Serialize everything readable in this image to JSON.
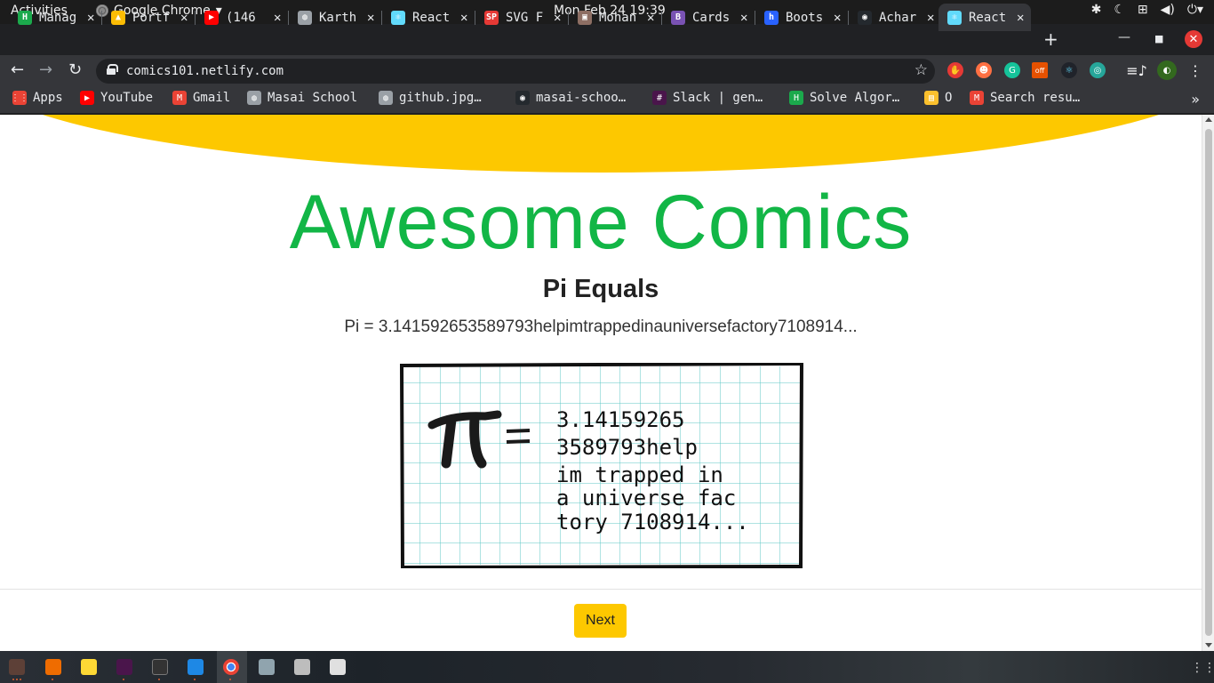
{
  "system": {
    "activities": "Activities",
    "app_name": "Google Chrome",
    "clock": "Mon Feb 24  19:39"
  },
  "tabs": [
    {
      "title": "Manag",
      "icon": "hackerrank-icon",
      "color": "#1ba94c",
      "glyph": "H"
    },
    {
      "title": "Portf",
      "icon": "google-drive-icon",
      "color": "#fbbc04",
      "glyph": "▲"
    },
    {
      "title": "(146",
      "icon": "youtube-icon",
      "color": "#ff0000",
      "glyph": "▶"
    },
    {
      "title": "Karth",
      "icon": "globe-icon",
      "color": "#9aa0a6",
      "glyph": "◍"
    },
    {
      "title": "React",
      "icon": "react-icon",
      "color": "#61dafb",
      "glyph": "⚛"
    },
    {
      "title": "SVG F",
      "icon": "svg-icon",
      "color": "#e53935",
      "glyph": "SP"
    },
    {
      "title": "Mohan",
      "icon": "photo-icon",
      "color": "#8d6e63",
      "glyph": "▣"
    },
    {
      "title": "Cards",
      "icon": "bootstrap-icon",
      "color": "#7952b3",
      "glyph": "B"
    },
    {
      "title": "Boots",
      "icon": "hashnode-icon",
      "color": "#2962ff",
      "glyph": "h"
    },
    {
      "title": "Achar",
      "icon": "github-icon",
      "color": "#24292e",
      "glyph": "◉"
    },
    {
      "title": "React",
      "icon": "react-icon",
      "color": "#61dafb",
      "glyph": "⚛",
      "active": true
    }
  ],
  "address": {
    "url": "comics101.netlify.com"
  },
  "bookmarks": [
    {
      "label": "Apps",
      "icon": "apps-grid-icon",
      "color": "#ea4335",
      "glyph": "⋮⋮"
    },
    {
      "label": "YouTube",
      "icon": "youtube-icon",
      "color": "#ff0000",
      "glyph": "▶"
    },
    {
      "label": "Gmail",
      "icon": "gmail-icon",
      "color": "#ea4335",
      "glyph": "M"
    },
    {
      "label": "Masai School",
      "icon": "globe-icon",
      "color": "#9aa0a6",
      "glyph": "◍"
    },
    {
      "label": "github.jpg…",
      "icon": "globe-icon",
      "color": "#9aa0a6",
      "glyph": "◍"
    },
    {
      "label": "masai-schoo…",
      "icon": "github-icon",
      "color": "#24292e",
      "glyph": "◉"
    },
    {
      "label": "Slack | gen…",
      "icon": "slack-icon",
      "color": "#4a154b",
      "glyph": "#"
    },
    {
      "label": "Solve Algor…",
      "icon": "hackerrank-icon",
      "color": "#1ba94c",
      "glyph": "H"
    },
    {
      "label": "O",
      "icon": "bookmark-folder-icon",
      "color": "#fbc02d",
      "glyph": "▤"
    },
    {
      "label": "Search resu…",
      "icon": "gmail-icon",
      "color": "#ea4335",
      "glyph": "M"
    }
  ],
  "page": {
    "site_title": "Awesome Comics",
    "comic_title": "Pi Equals",
    "comic_alt": "Pi = 3.141592653589793helpimtrappedinauniversefactory7108914...",
    "comic_lines": [
      "3.14159265",
      "3589793help",
      "im trapped in",
      "a universe fac",
      "tory 7108914..."
    ],
    "next_label": "Next",
    "colors": {
      "accent_yellow": "#fdc800",
      "title_green": "#12b646"
    }
  }
}
